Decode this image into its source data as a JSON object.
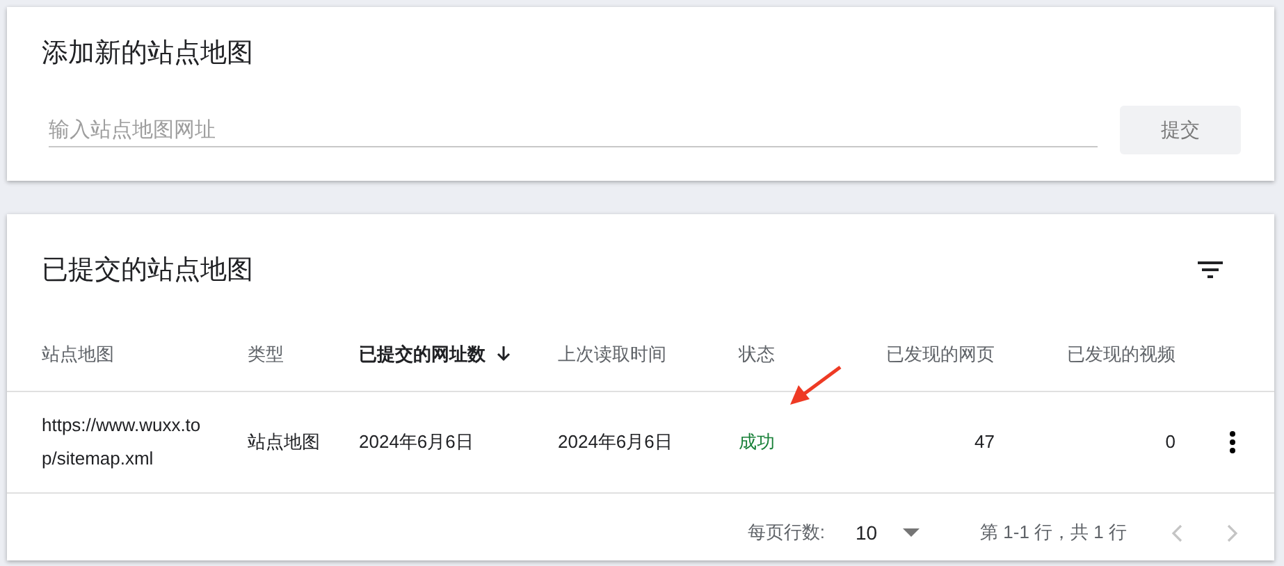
{
  "add_card": {
    "title": "添加新的站点地图",
    "url_field": {
      "placeholder": "输入站点地图网址"
    },
    "submit_button": {
      "label": "提交",
      "disabled": true
    }
  },
  "submitted_card": {
    "title": "已提交的站点地图",
    "table": {
      "columns": [
        {
          "label": "站点地图",
          "sorted": false
        },
        {
          "label": "类型",
          "sorted": false
        },
        {
          "label": "已提交的网址数",
          "sorted": true
        },
        {
          "label": "上次读取时间",
          "sorted": false
        },
        {
          "label": "状态",
          "sorted": false
        },
        {
          "label": "已发现的网页",
          "sorted": false
        },
        {
          "label": "已发现的视频",
          "sorted": false
        }
      ],
      "rows": [
        {
          "cells": [
            "https://www.wuxx.top/sitemap.xml",
            "站点地图",
            "2024年6月6日",
            "2024年6月6日",
            "成功",
            "47",
            "0"
          ],
          "success": true,
          "annotated": true
        }
      ]
    },
    "pagination": {
      "rows_per_page_label": "每页行数:",
      "rows_per_page": "10",
      "range": "第 1-1 行，共 1 行",
      "prev_disabled": true,
      "next_disabled": true
    }
  }
}
